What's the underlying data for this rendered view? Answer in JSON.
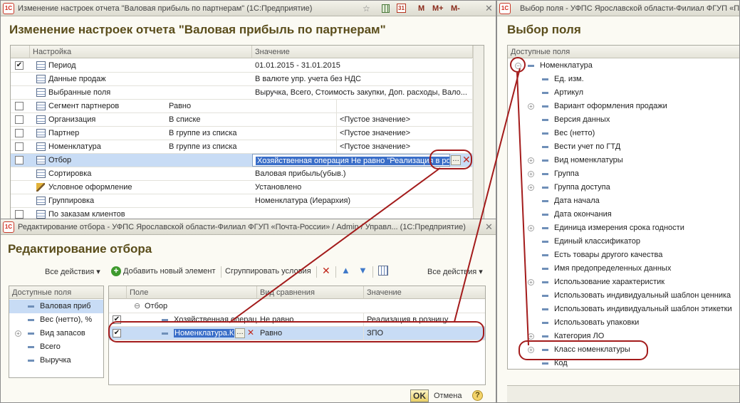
{
  "main_window": {
    "title": "Изменение настроек отчета \"Валовая прибыль по партнерам\" (1С:Предприятие)",
    "heading": "Изменение настроек отчета \"Валовая прибыль по партнерам\"",
    "toolbar": {
      "m": "M",
      "mplus": "M+",
      "mminus": "M-"
    },
    "columns": {
      "setting": "Настройка",
      "value": "Значение"
    },
    "rows": [
      {
        "name": "Период",
        "value": "01.01.2015 - 31.01.2015",
        "checked": "✔"
      },
      {
        "name": "Данные продаж",
        "value": "В валюте упр. учета без НДС"
      },
      {
        "name": "Выбранные поля",
        "value": "Выручка, Всего, Стоимость закупки, Доп. расходы, Вало..."
      },
      {
        "name": "Сегмент партнеров",
        "cmp": "Равно",
        "value": ""
      },
      {
        "name": "Организация",
        "cmp": "В списке",
        "value": "<Пустое значение>"
      },
      {
        "name": "Партнер",
        "cmp": "В группе из списка",
        "value": "<Пустое значение>"
      },
      {
        "name": "Номенклатура",
        "cmp": "В группе из списка",
        "value": "<Пустое значение>"
      },
      {
        "name": "Отбор",
        "value": "Хозяйственная операция Не равно \"Реализация в розн..."
      },
      {
        "name": "Сортировка",
        "value": "Валовая прибыль(убыв.)"
      },
      {
        "name": "Условное оформление",
        "value": "Установлено"
      },
      {
        "name": "Группировка",
        "value": "Номенклатура (Иерархия)"
      },
      {
        "name": "По заказам клиентов",
        "value": ""
      }
    ]
  },
  "filter_window": {
    "title": "Редактирование отбора - УФПС Ярославской области-Филиал ФГУП «Почта-России» / Admin / Управл... (1С:Предприятие)",
    "heading": "Редактирование отбора",
    "toolbar": {
      "all_actions_left": "Все действия ▾",
      "add_new": "Добавить новый элемент",
      "group_conditions": "Сгруппировать условия",
      "all_actions_right": "Все действия ▾"
    },
    "available_header": "Доступные поля",
    "available_fields": [
      "Валовая приб",
      "Вес (нетто), %",
      "Вид запасов",
      "Всего",
      "Выручка"
    ],
    "columns": {
      "field": "Поле",
      "cmp": "Вид сравнения",
      "value": "Значение"
    },
    "group_label": "Отбор",
    "rows": [
      {
        "field": "Хозяйственная операция",
        "cmp": "Не равно",
        "value": "Реализация в розницу"
      },
      {
        "field": "Номенклатура.К",
        "cmp": "Равно",
        "value": "ЗПО"
      }
    ],
    "ok": "OK",
    "cancel": "Отмена",
    "help": "?"
  },
  "field_window": {
    "title": "Выбор поля - УФПС Ярославской области-Филиал ФГУП «П",
    "heading": "Выбор поля",
    "header": "Доступные поля",
    "root": "Номенклатура",
    "items": [
      {
        "label": "Ед. изм.",
        "expand": false
      },
      {
        "label": "Артикул",
        "expand": false
      },
      {
        "label": "Вариант оформления продажи",
        "expand": true
      },
      {
        "label": "Версия данных",
        "expand": false
      },
      {
        "label": "Вес (нетто)",
        "expand": false
      },
      {
        "label": "Вести учет по ГТД",
        "expand": false
      },
      {
        "label": "Вид номенклатуры",
        "expand": true
      },
      {
        "label": "Группа",
        "expand": true
      },
      {
        "label": "Группа доступа",
        "expand": true
      },
      {
        "label": "Дата начала",
        "expand": false
      },
      {
        "label": "Дата окончания",
        "expand": false
      },
      {
        "label": "Единица измерения срока годности",
        "expand": true
      },
      {
        "label": "Единый классификатор",
        "expand": false
      },
      {
        "label": "Есть товары другого качества",
        "expand": false
      },
      {
        "label": "Имя предопределенных данных",
        "expand": false
      },
      {
        "label": "Использование характеристик",
        "expand": true
      },
      {
        "label": "Использовать индивидуальный шаблон ценника",
        "expand": false
      },
      {
        "label": "Использовать индивидуальный шаблон этикетки",
        "expand": false
      },
      {
        "label": "Использовать упаковки",
        "expand": false
      },
      {
        "label": "Категория ЛО",
        "expand": true
      },
      {
        "label": "Класс номенклатуры",
        "expand": true
      },
      {
        "label": "Код",
        "expand": false
      }
    ]
  },
  "colors": {
    "accent_red": "#a31b1b",
    "selection": "#3a6ec8",
    "title_text": "#5a4d1b"
  }
}
